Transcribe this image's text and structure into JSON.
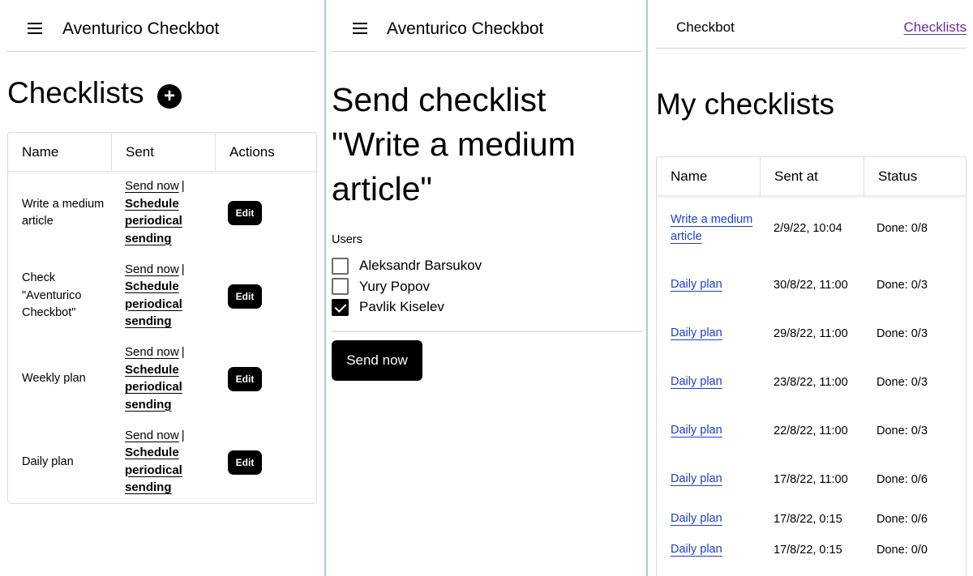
{
  "checklists_screen": {
    "app_title": "Aventurico Checkbot",
    "heading": "Checklists",
    "add_icon": "plus-icon",
    "menu_icon": "hamburger-menu-icon",
    "columns": [
      "Name",
      "Sent",
      "Actions"
    ],
    "send_now_label": "Send now",
    "separator": "|",
    "schedule_label": "Schedule periodical sending",
    "edit_label": "Edit",
    "rows": [
      {
        "name": "Write a medium article"
      },
      {
        "name": "Check \"Aventurico Checkbot\""
      },
      {
        "name": "Weekly plan"
      },
      {
        "name": "Daily plan"
      }
    ]
  },
  "send_screen": {
    "app_title": "Aventurico Checkbot",
    "menu_icon": "hamburger-menu-icon",
    "heading": "Send checklist \"Write a medium article\"",
    "users_label": "Users",
    "users": [
      {
        "name": "Aleksandr Barsukov",
        "checked": false
      },
      {
        "name": "Yury Popov",
        "checked": false
      },
      {
        "name": "Pavlik Kiselev",
        "checked": true
      }
    ],
    "send_button": "Send now"
  },
  "my_checklists_screen": {
    "nav_brand": "Checkbot",
    "nav_link": "Checklists",
    "heading": "My checklists",
    "columns": [
      "Name",
      "Sent at",
      "Status"
    ],
    "rows": [
      {
        "name": "Write a medium article",
        "sent_at": "2/9/22, 10:04",
        "status": "Done: 0/8"
      },
      {
        "name": "Daily plan",
        "sent_at": "30/8/22, 11:00",
        "status": "Done: 0/3"
      },
      {
        "name": "Daily plan",
        "sent_at": "29/8/22, 11:00",
        "status": "Done: 0/3"
      },
      {
        "name": "Daily plan",
        "sent_at": "23/8/22, 11:00",
        "status": "Done: 0/3"
      },
      {
        "name": "Daily plan",
        "sent_at": "22/8/22, 11:00",
        "status": "Done: 0/3"
      },
      {
        "name": "Daily plan",
        "sent_at": "17/8/22, 11:00",
        "status": "Done: 0/6"
      },
      {
        "name": "Daily plan",
        "sent_at": "17/8/22, 0:15",
        "status": "Done: 0/6"
      },
      {
        "name": "Daily plan",
        "sent_at": "17/8/22, 0:15",
        "status": "Done: 0/0"
      }
    ]
  },
  "colors": {
    "link_blue": "#1a3fd1",
    "visited_purple": "#6b2d90",
    "panel_separator": "#a9cbe3",
    "button_black": "#000000"
  }
}
